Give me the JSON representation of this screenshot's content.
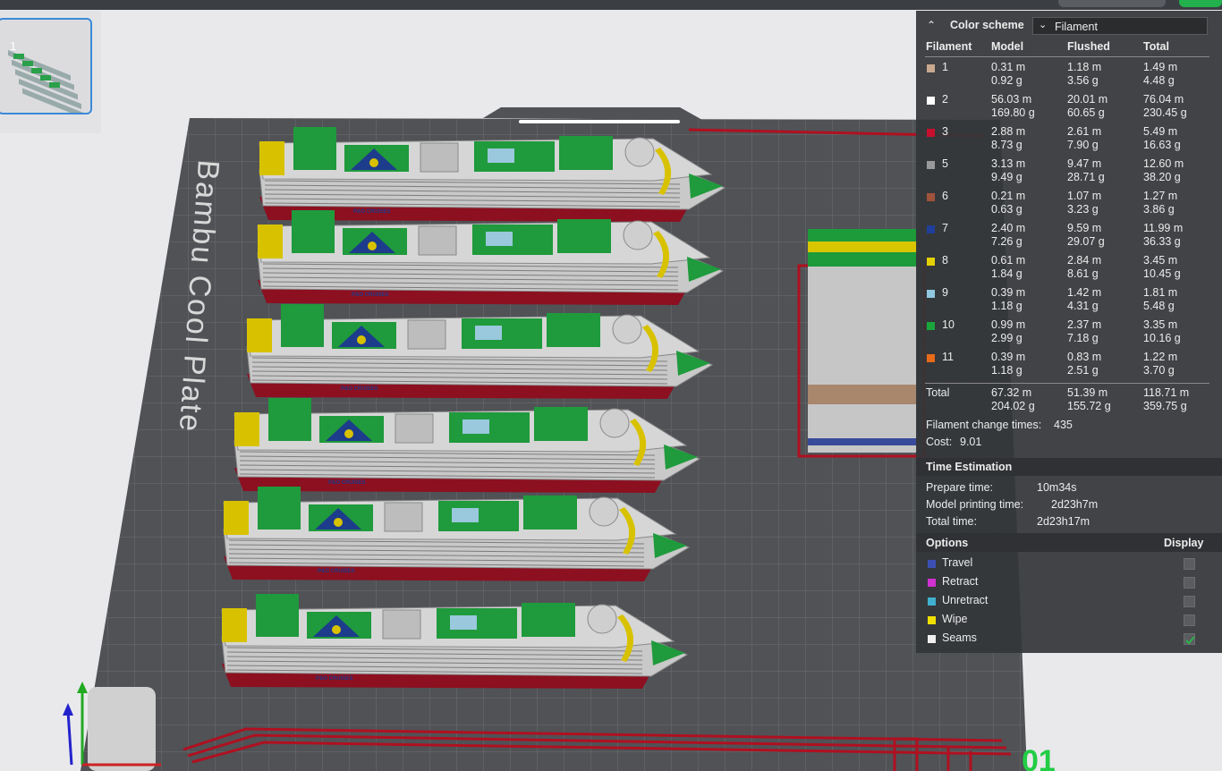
{
  "plate": {
    "number": "1",
    "label": "Bambu Cool Plate",
    "corner_mark": "01"
  },
  "ships": {
    "hull_text": "P&O CRUISES"
  },
  "panel": {
    "color_scheme_label": "Color scheme",
    "color_scheme_value": "Filament",
    "headers": {
      "filament": "Filament",
      "model": "Model",
      "flushed": "Flushed",
      "total": "Total"
    },
    "rows": [
      {
        "id": "1",
        "color": "#c8a98e",
        "model_m": "0.31 m",
        "model_g": "0.92 g",
        "flushed_m": "1.18 m",
        "flushed_g": "3.56 g",
        "total_m": "1.49 m",
        "total_g": "4.48 g"
      },
      {
        "id": "2",
        "color": "#ffffff",
        "model_m": "56.03 m",
        "model_g": "169.80 g",
        "flushed_m": "20.01 m",
        "flushed_g": "60.65 g",
        "total_m": "76.04 m",
        "total_g": "230.45 g"
      },
      {
        "id": "3",
        "color": "#c8102e",
        "model_m": "2.88 m",
        "model_g": "8.73 g",
        "flushed_m": "2.61 m",
        "flushed_g": "7.90 g",
        "total_m": "5.49 m",
        "total_g": "16.63 g"
      },
      {
        "id": "5",
        "color": "#9a9a9a",
        "model_m": "3.13 m",
        "model_g": "9.49 g",
        "flushed_m": "9.47 m",
        "flushed_g": "28.71 g",
        "total_m": "12.60 m",
        "total_g": "38.20 g"
      },
      {
        "id": "6",
        "color": "#a0523a",
        "model_m": "0.21 m",
        "model_g": "0.63 g",
        "flushed_m": "1.07 m",
        "flushed_g": "3.23 g",
        "total_m": "1.27 m",
        "total_g": "3.86 g"
      },
      {
        "id": "7",
        "color": "#1f3f9a",
        "model_m": "2.40 m",
        "model_g": "7.26 g",
        "flushed_m": "9.59 m",
        "flushed_g": "29.07 g",
        "total_m": "11.99 m",
        "total_g": "36.33 g"
      },
      {
        "id": "8",
        "color": "#e6d000",
        "model_m": "0.61 m",
        "model_g": "1.84 g",
        "flushed_m": "2.84 m",
        "flushed_g": "8.61 g",
        "total_m": "3.45 m",
        "total_g": "10.45 g"
      },
      {
        "id": "9",
        "color": "#8fc8e0",
        "model_m": "0.39 m",
        "model_g": "1.18 g",
        "flushed_m": "1.42 m",
        "flushed_g": "4.31 g",
        "total_m": "1.81 m",
        "total_g": "5.48 g"
      },
      {
        "id": "10",
        "color": "#1aa63c",
        "model_m": "0.99 m",
        "model_g": "2.99 g",
        "flushed_m": "2.37 m",
        "flushed_g": "7.18 g",
        "total_m": "3.35 m",
        "total_g": "10.16 g"
      },
      {
        "id": "11",
        "color": "#e86a1a",
        "model_m": "0.39 m",
        "model_g": "1.18 g",
        "flushed_m": "0.83 m",
        "flushed_g": "2.51 g",
        "total_m": "1.22 m",
        "total_g": "3.70 g"
      }
    ],
    "total": {
      "label": "Total",
      "model_m": "67.32 m",
      "model_g": "204.02 g",
      "flushed_m": "51.39 m",
      "flushed_g": "155.72 g",
      "total_m": "118.71 m",
      "total_g": "359.75 g"
    },
    "change_times_label": "Filament change times:",
    "change_times": "435",
    "cost_label": "Cost:",
    "cost": "9.01",
    "time_title": "Time Estimation",
    "prepare_label": "Prepare time:",
    "prepare_value": "10m34s",
    "model_time_label": "Model printing time:",
    "model_time_value": "2d23h7m",
    "total_time_label": "Total time:",
    "total_time_value": "2d23h17m",
    "options_title": "Options",
    "display_title": "Display",
    "options": [
      {
        "label": "Travel",
        "color": "#3c50b4",
        "checked": false
      },
      {
        "label": "Retract",
        "color": "#d030d0",
        "checked": false
      },
      {
        "label": "Unretract",
        "color": "#40b0d0",
        "checked": false
      },
      {
        "label": "Wipe",
        "color": "#f0e000",
        "checked": false
      },
      {
        "label": "Seams",
        "color": "#f0f0f0",
        "checked": true
      }
    ]
  }
}
